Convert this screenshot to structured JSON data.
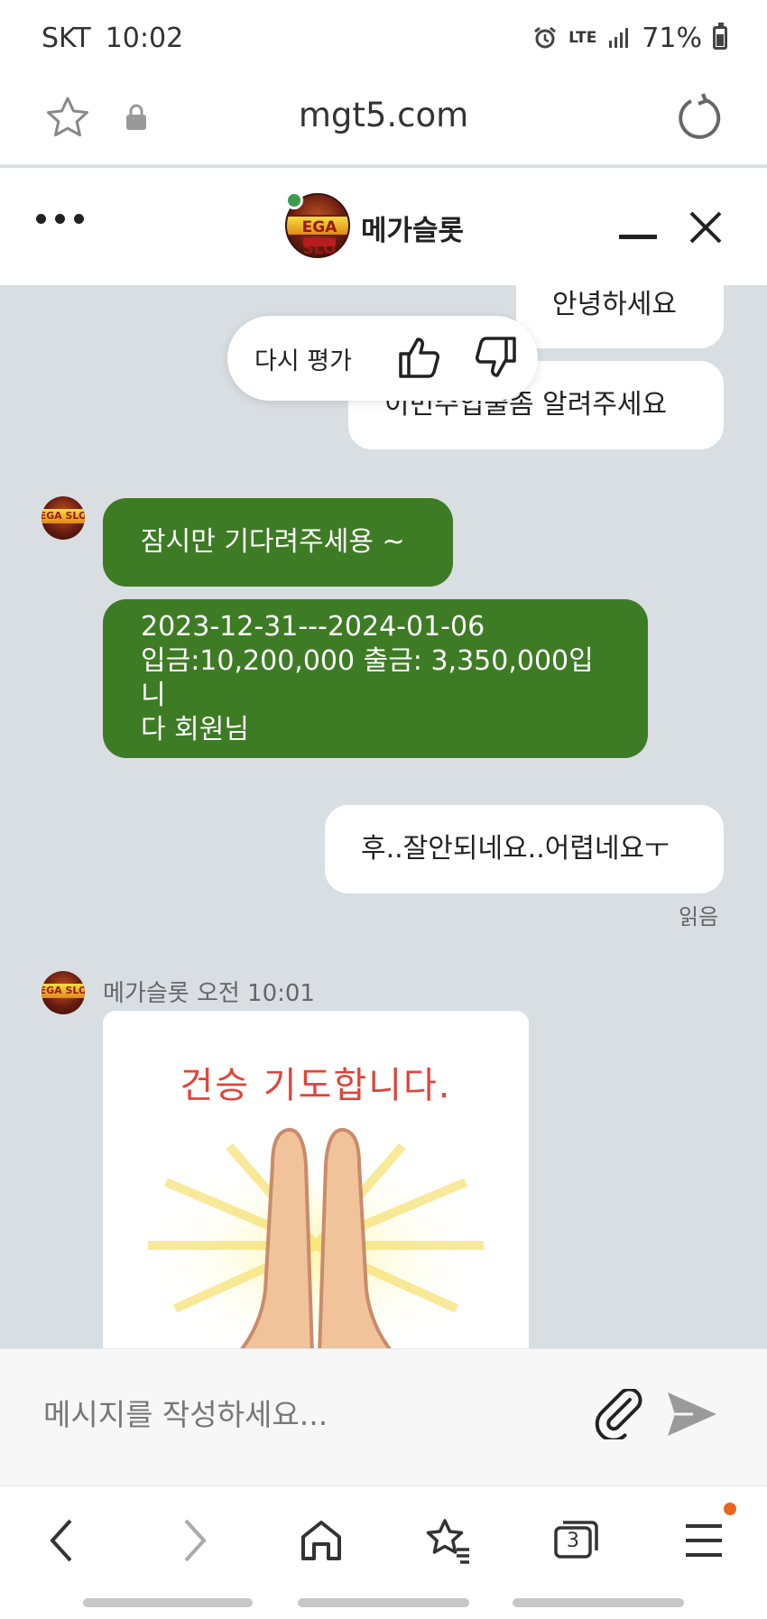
{
  "status_bar": {
    "carrier": "SKT",
    "time": "10:02",
    "network": "LTE",
    "battery": "71%"
  },
  "browser": {
    "url": "mgt5.com"
  },
  "chat_header": {
    "title": "메가슬롯",
    "avatar_logo": "EGA SLO"
  },
  "rating_popup": {
    "label": "다시 평가"
  },
  "messages": [
    {
      "from": "user",
      "text": "안녕하세요"
    },
    {
      "from": "user",
      "text": "이번주입출좀 알려주세요"
    },
    {
      "from": "agent",
      "text": "잠시만 기다려주세용 ~"
    },
    {
      "from": "agent",
      "text": "2023-12-31---2024-01-06\n입금:10,200,000 출금: 3,350,000입니\n다 회원님"
    },
    {
      "from": "user",
      "text": "후..잘안되네요..어렵네요ㅜ"
    }
  ],
  "read_receipt": "읽음",
  "image_message": {
    "sender_time": "메가슬롯 오전 10:01",
    "caption": "건승 기도합니다."
  },
  "composer": {
    "placeholder": "메시지를 작성하세요..."
  },
  "bottom_nav": {
    "tabs_count": "3"
  },
  "colors": {
    "agent_bubble": "#3e7b25",
    "chat_bg": "#d9dee3",
    "caption_red": "#e0443a",
    "notification_dot": "#e8671e"
  }
}
